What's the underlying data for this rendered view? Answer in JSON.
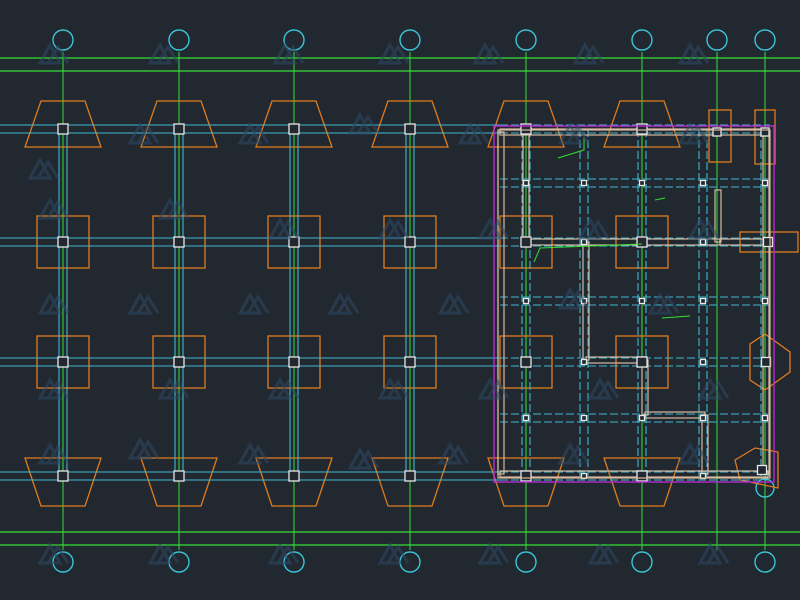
{
  "drawing": {
    "type": "foundation-plan",
    "background_color": "#212830",
    "colors": {
      "axis_line": "#35e035",
      "axis_bubble": "#39c5d8",
      "footing": "#e07b1e",
      "beam": "#3fb8cf",
      "column": "#e8e8e8",
      "brick_wall": "#d8b9a0",
      "slab_boundary": "#b82ad1",
      "watermark": "#2e4a66"
    },
    "grid": {
      "top_bubble_count": 9,
      "bottom_bubble_count": 9,
      "column_rows": 4,
      "column_cols_main": 6
    },
    "labels": {
      "top_axes": [
        "",
        "",
        "",
        "",
        "",
        "",
        "",
        "",
        ""
      ],
      "bottom_axes": [
        "",
        "",
        "",
        "",
        "",
        "",
        "",
        "",
        ""
      ]
    },
    "icons": {
      "watermark": "brand-logo-icon",
      "axis_bubble": "axis-bubble-icon",
      "column": "column-square-icon",
      "footing": "footing-pad-icon"
    }
  }
}
